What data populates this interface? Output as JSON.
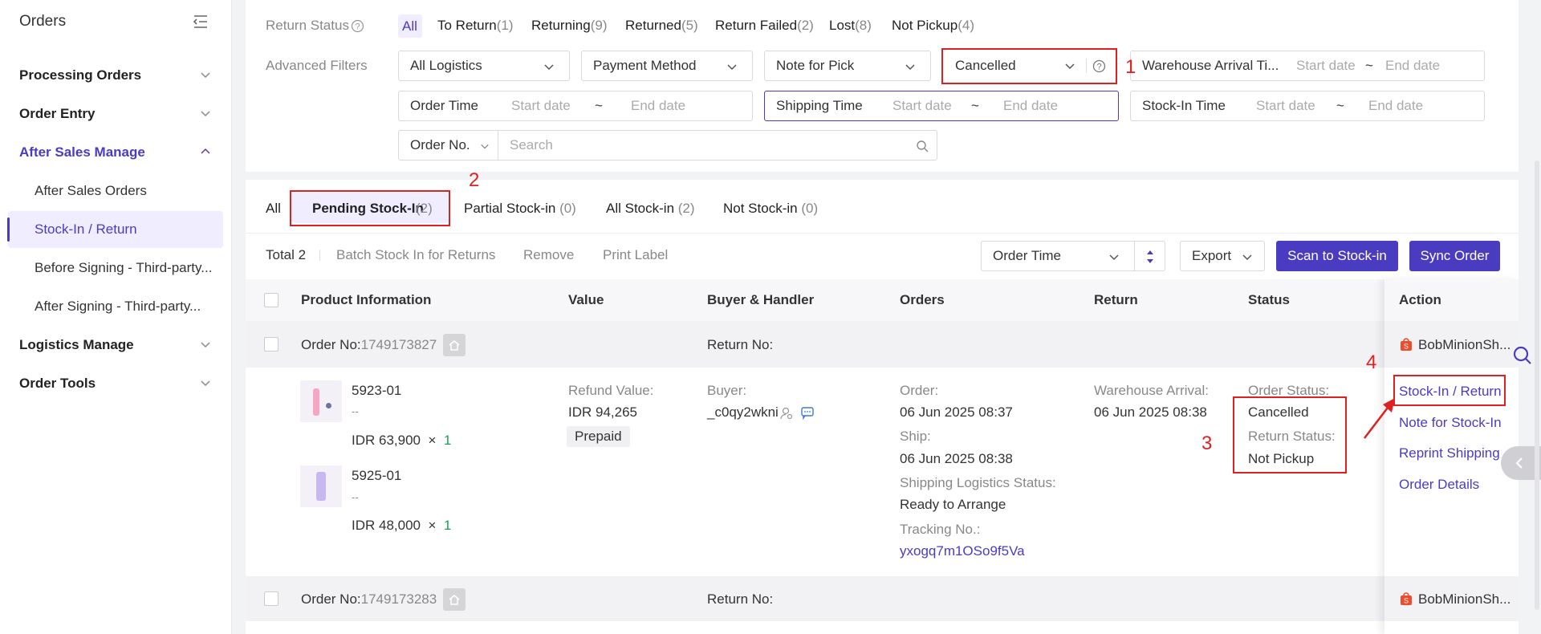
{
  "sidebar": {
    "title": "Orders",
    "items": [
      {
        "label": "Processing Orders"
      },
      {
        "label": "Order Entry"
      },
      {
        "label": "After Sales Manage"
      },
      {
        "label": "Logistics Manage"
      },
      {
        "label": "Order Tools"
      }
    ],
    "subitems": [
      {
        "label": "After Sales Orders"
      },
      {
        "label": "Stock-In / Return"
      },
      {
        "label": "Before Signing - Third-party..."
      },
      {
        "label": "After Signing - Third-party..."
      }
    ]
  },
  "filters": {
    "return_status_label": "Return Status",
    "status_tabs": [
      {
        "label": "All",
        "count": ""
      },
      {
        "label": "To Return",
        "count": "(1)"
      },
      {
        "label": "Returning",
        "count": "(9)"
      },
      {
        "label": "Returned",
        "count": "(5)"
      },
      {
        "label": "Return Failed",
        "count": "(2)"
      },
      {
        "label": "Lost",
        "count": "(8)"
      },
      {
        "label": "Not Pickup",
        "count": "(4)"
      }
    ],
    "advanced_label": "Advanced Filters",
    "logistics": "All Logistics",
    "payment": "Payment Method",
    "note_pick": "Note for Pick",
    "cancelled": "Cancelled",
    "warehouse_label": "Warehouse Arrival Ti...",
    "start_date": "Start date",
    "end_date": "End date",
    "tilde": "~",
    "order_time": "Order Time",
    "shipping_time": "Shipping Time",
    "stockin_time": "Stock-In Time",
    "order_no": "Order No.",
    "search_placeholder": "Search"
  },
  "stock_tabs": [
    {
      "label": "All",
      "count": ""
    },
    {
      "label": "Pending Stock-In",
      "count": "(2)"
    },
    {
      "label": "Partial Stock-in",
      "count": "(0)"
    },
    {
      "label": "All Stock-in",
      "count": "(2)"
    },
    {
      "label": "Not Stock-in",
      "count": "(0)"
    }
  ],
  "toolbar": {
    "total": "Total 2",
    "batch": "Batch Stock In for Returns",
    "remove": "Remove",
    "print": "Print Label",
    "sort": "Order Time",
    "export": "Export",
    "scan": "Scan to Stock-in",
    "sync": "Sync Order"
  },
  "table": {
    "headers": [
      "Product Information",
      "Value",
      "Buyer & Handler",
      "Orders",
      "Return",
      "Status",
      "Action"
    ],
    "order_no_label": "Order No:",
    "return_no_label": "Return No:",
    "rows": [
      {
        "order_no": "1749173827",
        "shop": "BobMinionSh...",
        "products": [
          {
            "sku": "5923-01",
            "dash": "--",
            "price": "IDR 63,900",
            "times": "×",
            "qty": "1"
          },
          {
            "sku": "5925-01",
            "dash": "--",
            "price": "IDR 48,000",
            "times": "×",
            "qty": "1"
          }
        ],
        "refund_label": "Refund Value:",
        "refund_value": "IDR 94,265",
        "prepaid": "Prepaid",
        "buyer_label": "Buyer:",
        "buyer": "_c0qy2wkni",
        "order_label": "Order:",
        "order_date": "06 Jun 2025 08:37",
        "ship_label": "Ship:",
        "ship_date": "06 Jun 2025 08:38",
        "logistics_label": "Shipping Logistics Status:",
        "logistics_status": "Ready to Arrange",
        "tracking_label": "Tracking No.:",
        "tracking": "yxogq7m1OSo9f5Va",
        "warehouse_label": "Warehouse Arrival:",
        "warehouse_date": "06 Jun 2025 08:38",
        "order_status_label": "Order Status:",
        "order_status": "Cancelled",
        "return_status_label": "Return Status:",
        "return_status": "Not Pickup",
        "actions": [
          "Stock-In / Return",
          "Note for Stock-In",
          "Reprint Shipping",
          "Order Details"
        ]
      },
      {
        "order_no": "1749173283",
        "shop": "BobMinionSh..."
      }
    ]
  },
  "annotations": [
    "1",
    "2",
    "3",
    "4"
  ],
  "colors": {
    "accent": "#4a3cc1",
    "annotation": "#e02020",
    "qty": "#18a058"
  }
}
